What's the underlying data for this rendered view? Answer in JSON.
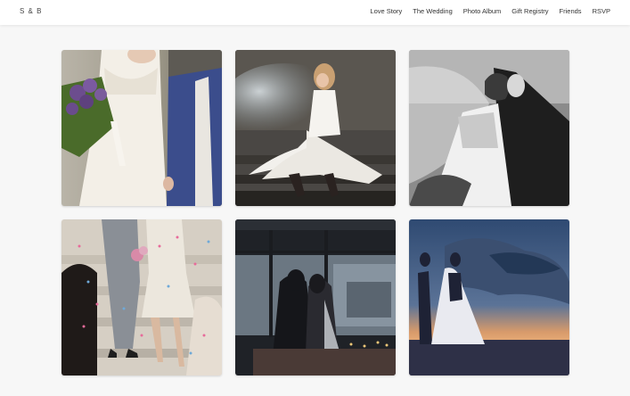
{
  "header": {
    "brand": "S & B",
    "nav": [
      {
        "label": "Love Story"
      },
      {
        "label": "The Wedding"
      },
      {
        "label": "Photo Album"
      },
      {
        "label": "Gift Registry"
      },
      {
        "label": "Friends"
      },
      {
        "label": "RSVP"
      }
    ]
  },
  "gallery": {
    "photos": [
      {
        "icon": "bride-groom-bouquet-photo"
      },
      {
        "icon": "bride-sitting-steps-photo"
      },
      {
        "icon": "couple-kiss-bw-photo"
      },
      {
        "icon": "couple-confetti-steps-photo"
      },
      {
        "icon": "couple-window-silhouette-photo"
      },
      {
        "icon": "couple-sunset-silhouette-photo"
      }
    ]
  }
}
